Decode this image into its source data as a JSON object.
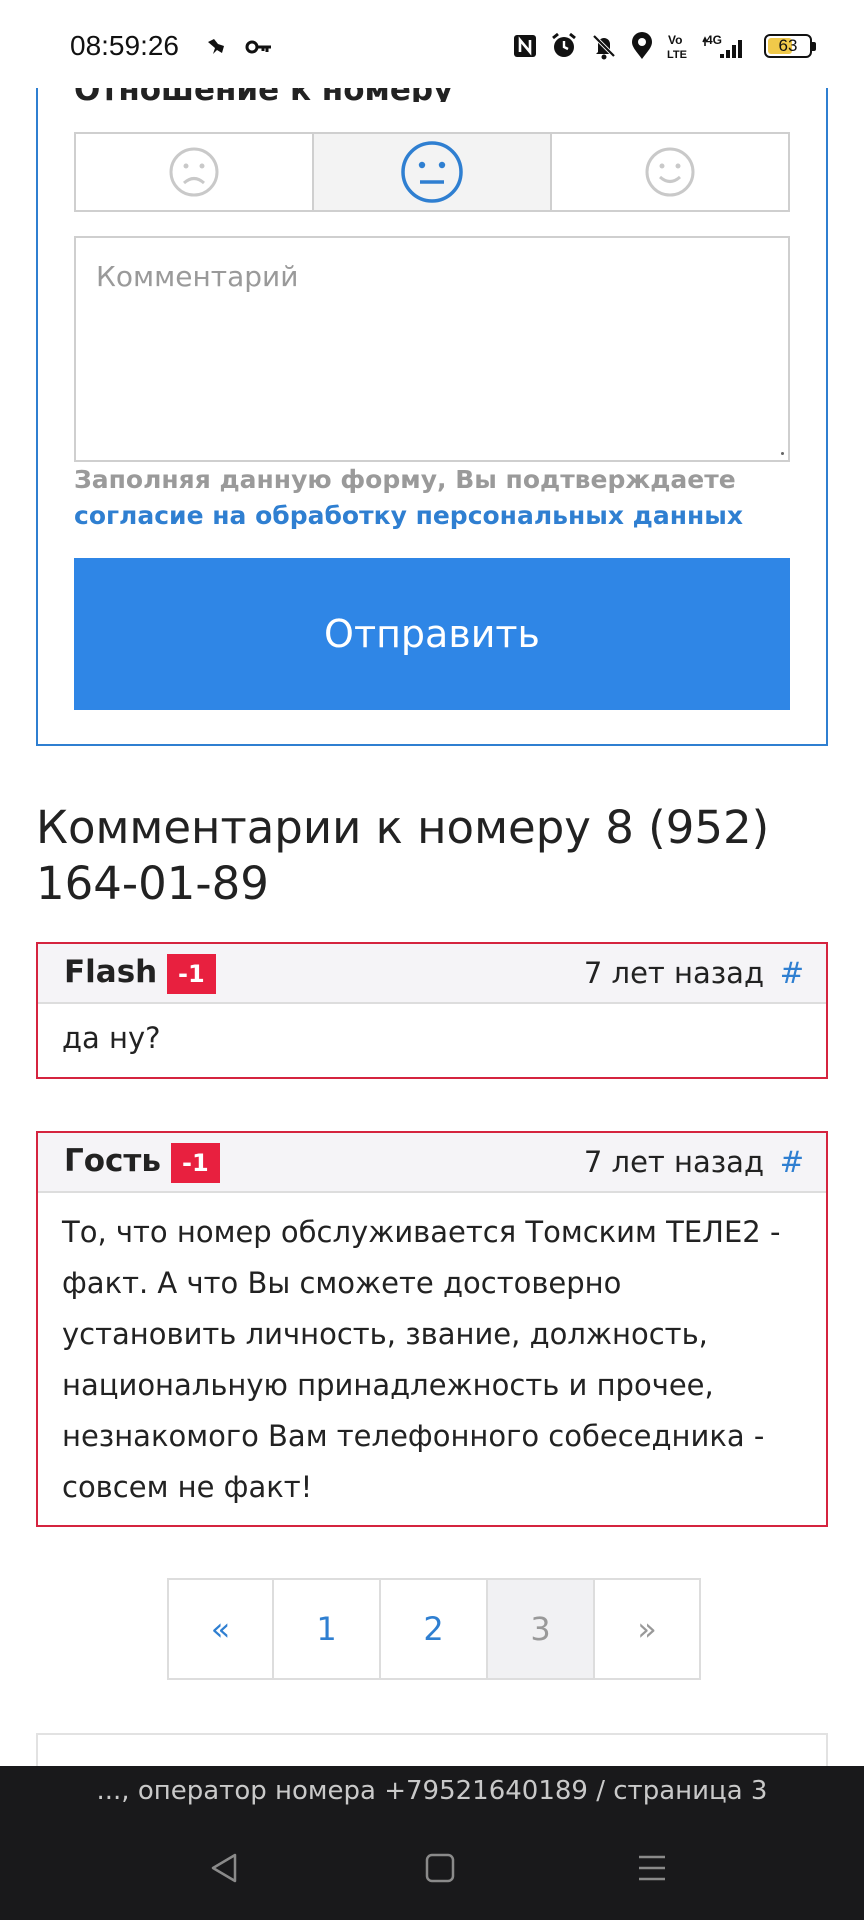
{
  "status_bar": {
    "time": "08:59:26",
    "battery_level": "63",
    "battery_fraction": 0.63,
    "left_icons": [
      "bird-icon",
      "key-icon"
    ],
    "right_icons": [
      "nfc-icon",
      "alarm-icon",
      "mute-icon",
      "location-icon",
      "volte-icon",
      "signal-4g-icon",
      "battery-icon"
    ],
    "network_label": "4G",
    "volte_label": "Vo LTE"
  },
  "form": {
    "heading": "Отношение к номеру",
    "ratings": [
      {
        "name": "negative",
        "icon": "sad-face-icon",
        "selected": false
      },
      {
        "name": "neutral",
        "icon": "neutral-face-icon",
        "selected": true
      },
      {
        "name": "positive",
        "icon": "happy-face-icon",
        "selected": false
      }
    ],
    "comment_placeholder": "Комментарий",
    "consent_text": "Заполняя данную форму, Вы подтверждаете",
    "consent_link": "согласие на обработку персональных данных",
    "submit_label": "Отправить"
  },
  "comments": {
    "title": "Комментарии к номеру 8 (952) 164-01-89",
    "items": [
      {
        "author": "Flash",
        "score": "-1",
        "time": "7 лет назад",
        "anchor": "#",
        "text": "да ну?"
      },
      {
        "author": "Гость",
        "score": "-1",
        "time": "7 лет назад",
        "anchor": "#",
        "text": "То, что номер обслуживается Томским ТЕЛЕ2 - факт. А что Вы сможете достоверно установить личность, звание, должность, национальную принадлежность и прочее, незнакомого Вам телефонного собеседника - совсем не факт!"
      }
    ]
  },
  "pagination": {
    "prev": "«",
    "pages": [
      "1",
      "2",
      "3"
    ],
    "active": "3",
    "next": "»"
  },
  "browser": {
    "url_title": "..., оператор номера +79521640189 / страница 3"
  },
  "nav": {
    "back": "back-triangle-icon",
    "home": "home-square-icon",
    "menu": "menu-lines-icon"
  },
  "colors": {
    "accent": "#2f86e6",
    "link": "#2f7fd1",
    "danger": "#e8203f",
    "card_border": "#d5243f",
    "battery": "#f0c94a"
  }
}
